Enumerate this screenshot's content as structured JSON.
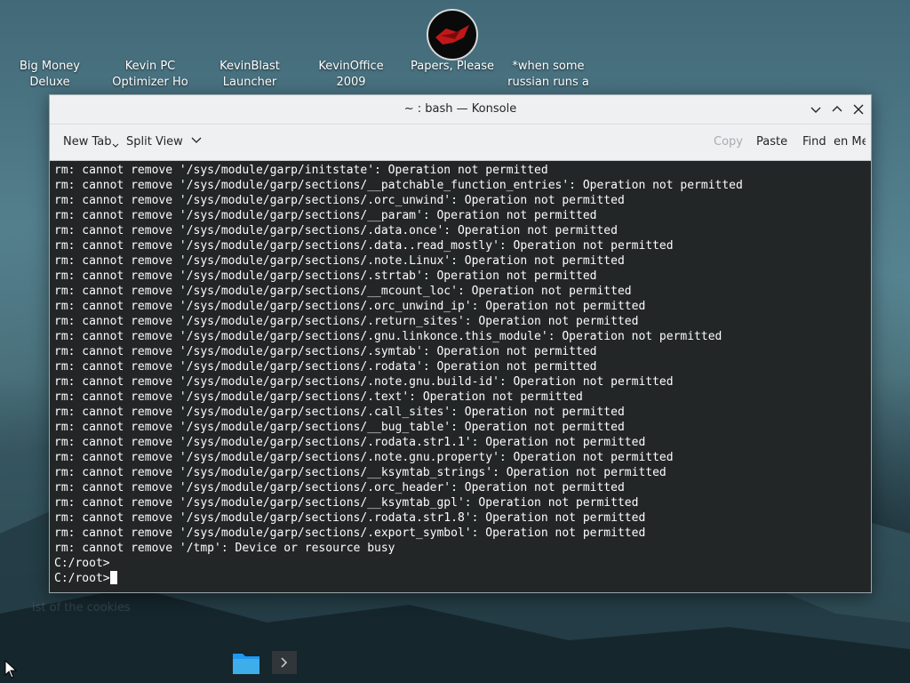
{
  "desktop": {
    "icons": [
      {
        "label": "Big Money\nDeluxe"
      },
      {
        "label": "Kevin PC\nOptimizer Ho"
      },
      {
        "label": "KevinBlast\nLauncher"
      },
      {
        "label": "KevinOffice\n2009"
      },
      {
        "label": "Papers, Please"
      },
      {
        "label": "*when some\nrussian runs a"
      }
    ],
    "hidden_label": "ist of the cookies"
  },
  "window": {
    "title": "~ : bash — Konsole",
    "toolbar": {
      "new_tab": "New Tab",
      "split_view": "Split View",
      "copy": "Copy",
      "paste": "Paste",
      "find": "Find",
      "menu": "en Me"
    }
  },
  "terminal": {
    "lines": [
      "rm: cannot remove '/sys/module/garp/initstate': Operation not permitted",
      "rm: cannot remove '/sys/module/garp/sections/__patchable_function_entries': Operation not permitted",
      "rm: cannot remove '/sys/module/garp/sections/.orc_unwind': Operation not permitted",
      "rm: cannot remove '/sys/module/garp/sections/__param': Operation not permitted",
      "rm: cannot remove '/sys/module/garp/sections/.data.once': Operation not permitted",
      "rm: cannot remove '/sys/module/garp/sections/.data..read_mostly': Operation not permitted",
      "rm: cannot remove '/sys/module/garp/sections/.note.Linux': Operation not permitted",
      "rm: cannot remove '/sys/module/garp/sections/.strtab': Operation not permitted",
      "rm: cannot remove '/sys/module/garp/sections/__mcount_loc': Operation not permitted",
      "rm: cannot remove '/sys/module/garp/sections/.orc_unwind_ip': Operation not permitted",
      "rm: cannot remove '/sys/module/garp/sections/.return_sites': Operation not permitted",
      "rm: cannot remove '/sys/module/garp/sections/.gnu.linkonce.this_module': Operation not permitted",
      "rm: cannot remove '/sys/module/garp/sections/.symtab': Operation not permitted",
      "rm: cannot remove '/sys/module/garp/sections/.rodata': Operation not permitted",
      "rm: cannot remove '/sys/module/garp/sections/.note.gnu.build-id': Operation not permitted",
      "rm: cannot remove '/sys/module/garp/sections/.text': Operation not permitted",
      "rm: cannot remove '/sys/module/garp/sections/.call_sites': Operation not permitted",
      "rm: cannot remove '/sys/module/garp/sections/__bug_table': Operation not permitted",
      "rm: cannot remove '/sys/module/garp/sections/.rodata.str1.1': Operation not permitted",
      "rm: cannot remove '/sys/module/garp/sections/.note.gnu.property': Operation not permitted",
      "rm: cannot remove '/sys/module/garp/sections/__ksymtab_strings': Operation not permitted",
      "rm: cannot remove '/sys/module/garp/sections/.orc_header': Operation not permitted",
      "rm: cannot remove '/sys/module/garp/sections/__ksymtab_gpl': Operation not permitted",
      "rm: cannot remove '/sys/module/garp/sections/.rodata.str1.8': Operation not permitted",
      "rm: cannot remove '/sys/module/garp/sections/.export_symbol': Operation not permitted",
      "rm: cannot remove '/tmp': Device or resource busy",
      "C:/root>"
    ],
    "prompt": "C:/root>"
  },
  "colors": {
    "terminal_bg": "#232627",
    "terminal_fg": "#fcfcfc",
    "accent": "#3daee9",
    "chrome": "#eff0f1"
  }
}
